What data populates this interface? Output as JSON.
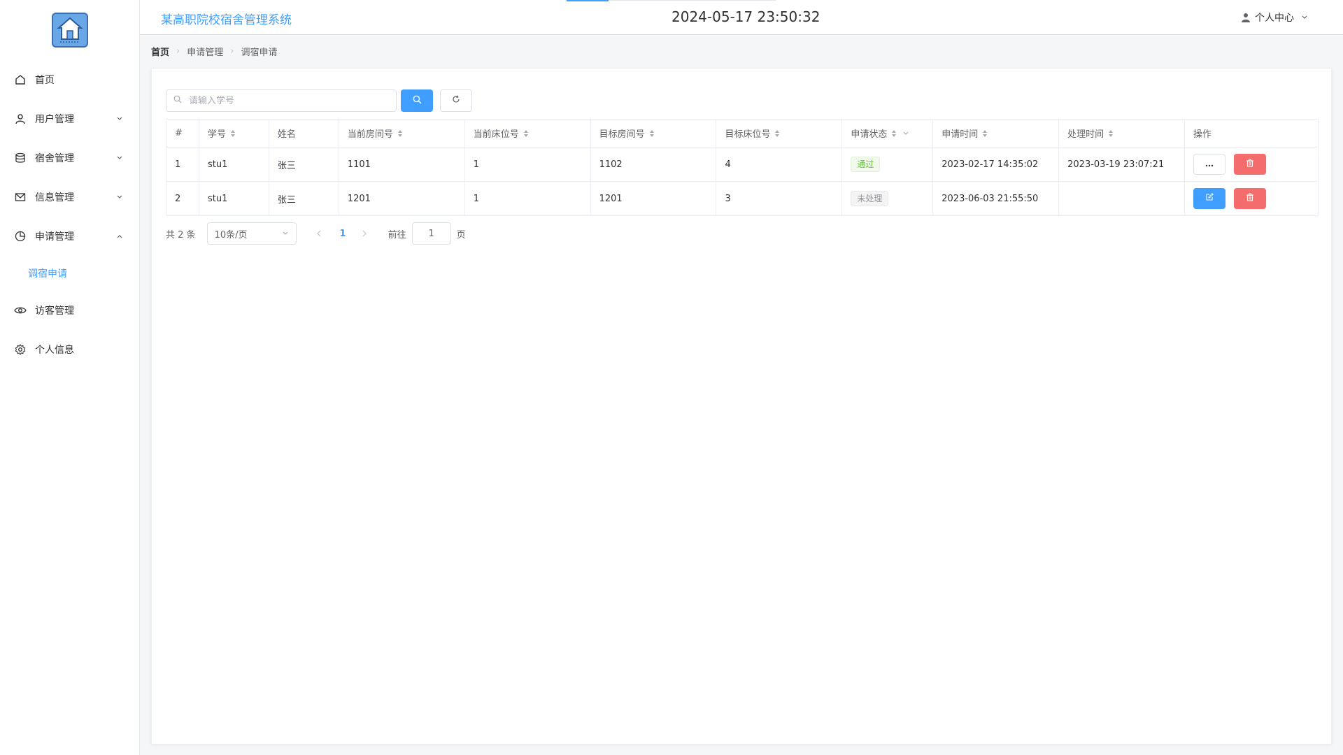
{
  "header": {
    "system_title": "某高职院校宿舍管理系统",
    "clock": "2024-05-17 23:50:32",
    "user_center_label": "个人中心"
  },
  "sidebar": {
    "items": [
      {
        "label": "首页",
        "icon": "home-icon"
      },
      {
        "label": "用户管理",
        "icon": "user-icon"
      },
      {
        "label": "宿舍管理",
        "icon": "database-icon"
      },
      {
        "label": "信息管理",
        "icon": "mail-icon"
      },
      {
        "label": "申请管理",
        "icon": "pie-chart-icon"
      },
      {
        "label": "访客管理",
        "icon": "eye-icon"
      },
      {
        "label": "个人信息",
        "icon": "gear-icon"
      }
    ],
    "submenu_active": "调宿申请"
  },
  "breadcrumb": {
    "home": "首页",
    "section": "申请管理",
    "current": "调宿申请"
  },
  "search": {
    "placeholder": "请输入学号"
  },
  "table": {
    "headers": {
      "index": "#",
      "student_id": "学号",
      "name": "姓名",
      "current_room": "当前房间号",
      "current_bed": "当前床位号",
      "target_room": "目标房间号",
      "target_bed": "目标床位号",
      "status": "申请状态",
      "apply_time": "申请时间",
      "process_time": "处理时间",
      "actions": "操作"
    },
    "rows": [
      {
        "index": "1",
        "student_id": "stu1",
        "name": "张三",
        "current_room": "1101",
        "current_bed": "1",
        "target_room": "1102",
        "target_bed": "4",
        "status": "通过",
        "apply_time": "2023-02-17 14:35:02",
        "process_time": "2023-03-19 23:07:21"
      },
      {
        "index": "2",
        "student_id": "stu1",
        "name": "张三",
        "current_room": "1201",
        "current_bed": "1",
        "target_room": "1201",
        "target_bed": "3",
        "status": "未处理",
        "apply_time": "2023-06-03 21:55:50",
        "process_time": ""
      }
    ]
  },
  "pagination": {
    "total_label": "共 2 条",
    "page_size": "10条/页",
    "current_page": "1",
    "goto_label": "前往",
    "goto_value": "1",
    "page_suffix": "页"
  },
  "colors": {
    "primary": "#409eff",
    "danger": "#f56c6c",
    "success": "#67c23a"
  }
}
